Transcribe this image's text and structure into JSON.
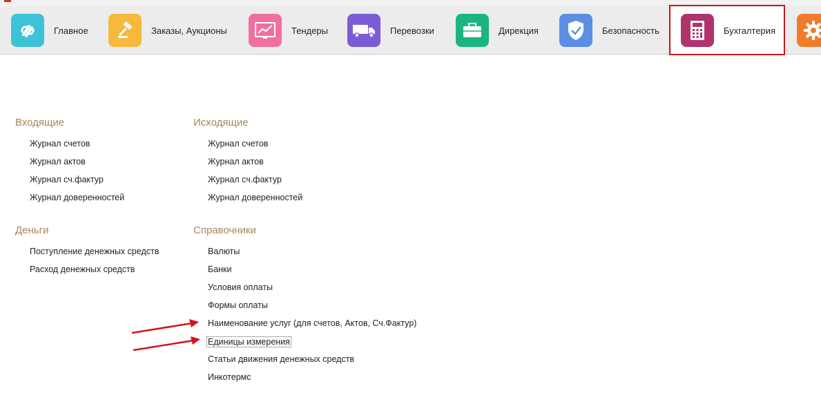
{
  "toolbar": {
    "items": [
      {
        "label": "Главное",
        "icon": "logo-link-icon",
        "color": "#3cc3d8"
      },
      {
        "label": "Заказы, Аукционы",
        "icon": "gavel-icon",
        "color": "#f6b93b"
      },
      {
        "label": "Тендеры",
        "icon": "line-chart-icon",
        "color": "#f06fa0"
      },
      {
        "label": "Перевозки",
        "icon": "truck-icon",
        "color": "#7b5cd6"
      },
      {
        "label": "Дирекция",
        "icon": "briefcase-icon",
        "color": "#1bb584"
      },
      {
        "label": "Безопасность",
        "icon": "shield-check-icon",
        "color": "#5b8fe6"
      },
      {
        "label": "Бухгалтерия",
        "icon": "calculator-icon",
        "color": "#b0336e",
        "active": true
      },
      {
        "label": "",
        "icon": "gear-icon",
        "color": "#f07c2a"
      }
    ]
  },
  "sections": {
    "incoming": {
      "title": "Входящие",
      "links": [
        "Журнал счетов",
        "Журнал актов",
        "Журнал сч.фактур",
        "Журнал доверенностей"
      ]
    },
    "outgoing": {
      "title": "Исходящие",
      "links": [
        "Журнал счетов",
        "Журнал актов",
        "Журнал сч.фактур",
        "Журнал доверенностей"
      ]
    },
    "money": {
      "title": "Деньги",
      "links": [
        "Поступление денежных средств",
        "Расход денежных средств"
      ]
    },
    "references": {
      "title": "Справочники",
      "links": [
        "Валюты",
        "Банки",
        "Условия оплаты",
        "Формы оплаты",
        "Наименование услуг (для счетов, Актов, Сч.Фактур)",
        "Единицы измерения",
        "Статьи движения денежных средств",
        "Инкотермс"
      ]
    }
  },
  "colors": {
    "accent_frame": "#d0141a",
    "section_title": "#a8865a",
    "annotation_arrow": "#d0141a"
  }
}
